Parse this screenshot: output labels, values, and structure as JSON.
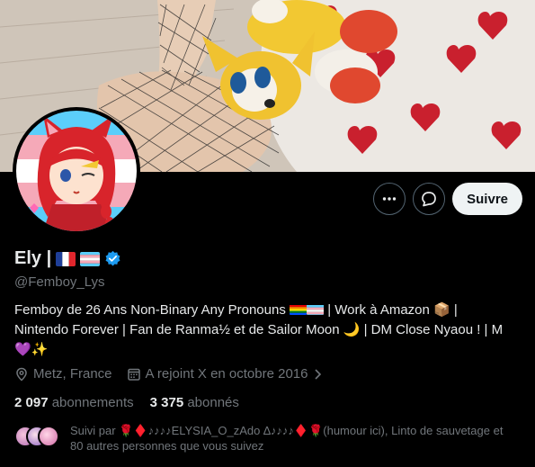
{
  "profile": {
    "name": "Ely |",
    "handle": "@Femboy_Lys",
    "bio_line1": "Femboy de 26 Ans Non-Binary Any Pronouns",
    "bio_line1_b": "| Work à Amazon 📦 |",
    "bio_line2": "Nintendo Forever  | Fan de Ranma½ et de Sailor Moon 🌙 | DM Close Nyaou ! | M",
    "bio_line3": "💜✨",
    "location": "Metz, France",
    "joined": "A rejoint X en octobre 2016"
  },
  "actions": {
    "follow_label": "Suivre"
  },
  "stats": {
    "following_count": "2 097",
    "following_label": "abonnements",
    "followers_count": "3 375",
    "followers_label": "abonnés"
  },
  "followed_by": {
    "line1": "Suivi par 🌹♦️♪♪♪♪ELYSIA_O_zAdo ∆♪♪♪♪♦️🌹(humour ici), Linto de sauvetage et",
    "line2": "80 autres personnes que vous suivez"
  },
  "colors": {
    "background": "#000000",
    "text_primary": "#e7e9ea",
    "text_secondary": "#71767b",
    "verified_blue": "#1d9bf0",
    "follow_button_bg": "#eff3f4"
  },
  "icons": {
    "more": "more-dots-icon",
    "message": "message-bubble-icon",
    "verified": "verified-badge-icon",
    "location": "location-pin-icon",
    "calendar": "calendar-icon",
    "chevron": "chevron-right-icon"
  }
}
